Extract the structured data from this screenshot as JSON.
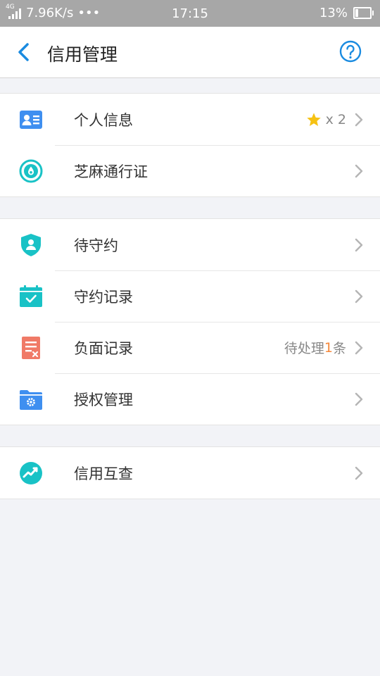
{
  "status": {
    "network": "4G",
    "speed": "7.96K/s",
    "more": "•••",
    "time": "17:15",
    "battery": "13%"
  },
  "header": {
    "title": "信用管理"
  },
  "groups": [
    [
      {
        "label": "个人信息",
        "extra_suffix": "x 2"
      },
      {
        "label": "芝麻通行证"
      }
    ],
    [
      {
        "label": "待守约"
      },
      {
        "label": "守约记录"
      },
      {
        "label": "负面记录",
        "extra_pre": "待处理",
        "extra_count": "1",
        "extra_post": "条"
      },
      {
        "label": "授权管理"
      }
    ],
    [
      {
        "label": "信用互查"
      }
    ]
  ],
  "colors": {
    "accent": "#1a8be0",
    "teal": "#19c2c6",
    "blue_icon": "#3f8ff0",
    "red_icon": "#f07a67",
    "star": "#f6c213",
    "count": "#f5883b"
  }
}
